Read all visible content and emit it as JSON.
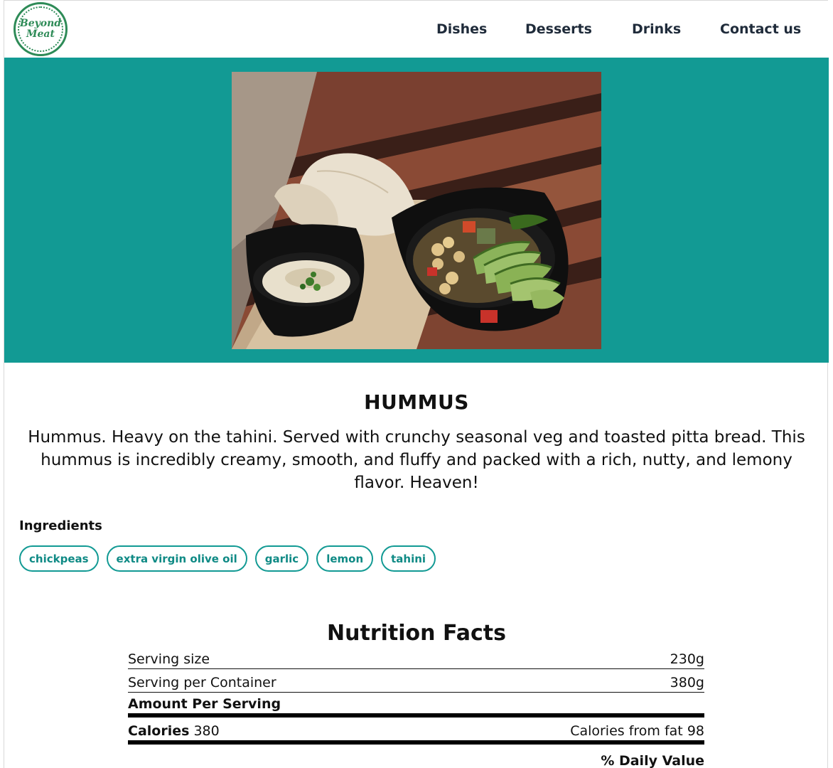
{
  "brand": {
    "logo_text": "Beyond\nMeat"
  },
  "nav": {
    "items": [
      {
        "label": "Dishes"
      },
      {
        "label": "Desserts"
      },
      {
        "label": "Drinks"
      },
      {
        "label": "Contact us"
      }
    ]
  },
  "colors": {
    "accent": "#129a94",
    "logo": "#2e8b57",
    "nav_text": "#1f2b3a"
  },
  "dish": {
    "title": "HUMMUS",
    "description": "Hummus. Heavy on the tahini. Served with crunchy seasonal veg and toasted pitta bread. This hummus is incredibly creamy, smooth, and fluffy and packed with a rich, nutty, and lemony flavor. Heaven!",
    "ingredients_label": "Ingredients",
    "ingredients": [
      "chickpeas",
      "extra virgin olive oil",
      "garlic",
      "lemon",
      "tahini"
    ]
  },
  "nutrition": {
    "title": "Nutrition Facts",
    "serving_size_label": "Serving size",
    "serving_size_value": "230g",
    "serving_per_container_label": "Serving per Container",
    "serving_per_container_value": "380g",
    "amount_per_serving_label": "Amount Per Serving",
    "calories_label": "Calories",
    "calories_value": "380",
    "calories_from_fat_label": "Calories from fat",
    "calories_from_fat_value": "98",
    "daily_value_label": "% Daily Value"
  }
}
